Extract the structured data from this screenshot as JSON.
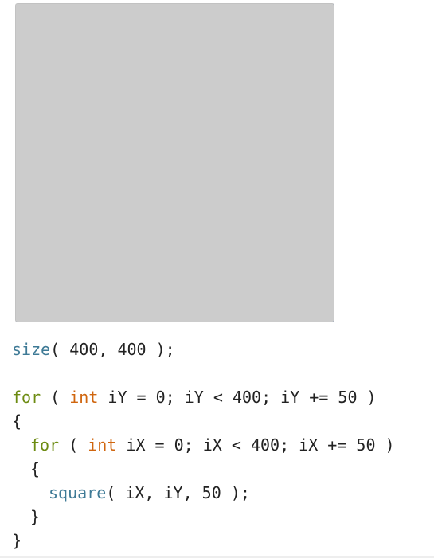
{
  "canvas": {
    "background": "#cccccc"
  },
  "colors": {
    "function": "#3e7a96",
    "keyword": "#6d8b12",
    "type": "#d0660f",
    "text": "#222222"
  },
  "code": {
    "line1": {
      "fn": "size",
      "rest": "( 400, 400 );"
    },
    "line3": {
      "kw": "for",
      "a": " ( ",
      "ty": "int",
      "rest": " iY = 0; iY < 400; iY += 50 )"
    },
    "line4": {
      "text": "{"
    },
    "line5": {
      "kw": "for",
      "a": " ( ",
      "ty": "int",
      "rest": " iX = 0; iX < 400; iX += 50 )"
    },
    "line6": {
      "text": "{"
    },
    "line7": {
      "fn": "square",
      "rest": "( iX, iY, 50 );"
    },
    "line8": {
      "text": "}"
    },
    "line9": {
      "text": "}"
    }
  }
}
